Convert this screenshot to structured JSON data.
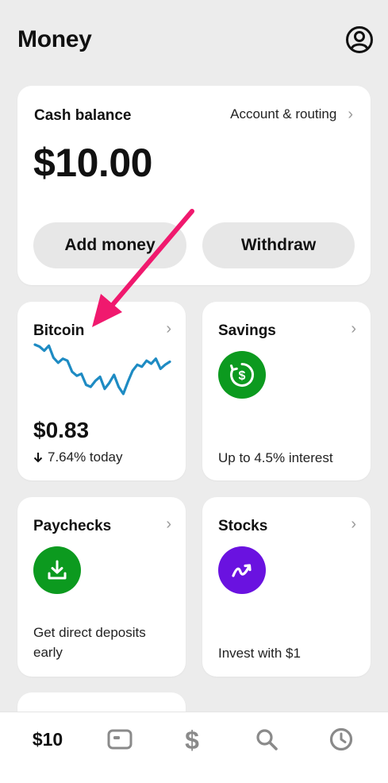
{
  "header": {
    "title": "Money",
    "profile_icon": "user-circle-icon"
  },
  "balance_card": {
    "label": "Cash balance",
    "account_link": "Account & routing",
    "amount": "$10.00",
    "add_money_label": "Add money",
    "withdraw_label": "Withdraw"
  },
  "bitcoin": {
    "label": "Bitcoin",
    "price": "$0.83",
    "change": "7.64% today",
    "change_direction": "down",
    "chart_color": "#1e8bc3",
    "chart_data": {
      "type": "line",
      "values": [
        8.2,
        8.0,
        7.6,
        8.1,
        6.9,
        6.4,
        6.8,
        6.6,
        5.5,
        5.1,
        5.3,
        4.2,
        4.0,
        4.6,
        5.0,
        3.8,
        4.4,
        5.2,
        4.0,
        3.3,
        4.5,
        5.6,
        6.2,
        6.0,
        6.6,
        6.3,
        6.8,
        5.8,
        6.2,
        6.5
      ]
    }
  },
  "savings": {
    "label": "Savings",
    "description": "Up to 4.5% interest",
    "icon": "dollar-circle-icon"
  },
  "paychecks": {
    "label": "Paychecks",
    "description": "Get direct deposits early",
    "icon": "download-icon"
  },
  "stocks": {
    "label": "Stocks",
    "description": "Invest with $1",
    "icon": "trend-up-icon"
  },
  "tabbar": {
    "balance_label": "$10",
    "items": [
      "card-icon",
      "dollar-icon",
      "search-icon",
      "clock-icon"
    ]
  },
  "colors": {
    "green": "#0c9a1f",
    "purple": "#6a12e0",
    "annotation_arrow": "#f0196e"
  }
}
